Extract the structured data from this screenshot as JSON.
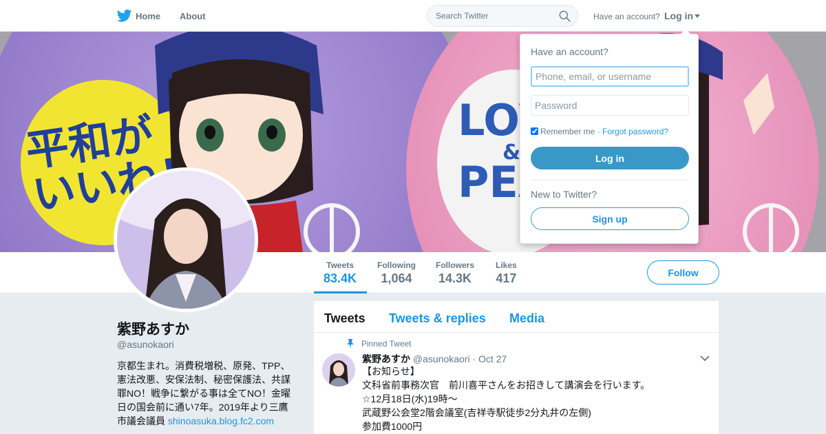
{
  "nav": {
    "home_label": "Home",
    "about_label": "About",
    "search_placeholder": "Search Twitter",
    "have_account": "Have an account?",
    "login_label": "Log in",
    "logo_icon": "twitter-bird-icon",
    "search_icon": "search-icon"
  },
  "colors": {
    "accent": "#1b95e0",
    "button_blue": "#3a98c8",
    "muted": "#657786",
    "background": "#e6ecf0"
  },
  "banner": {
    "badge_left_text_line1": "平和が",
    "badge_left_text_line2": "いいね！",
    "badge_right_text_line1": "LOV",
    "badge_right_text_line2": "&",
    "badge_right_text_line3": "PEA"
  },
  "profile": {
    "name": "紫野あすか",
    "handle": "@asunokaori",
    "bio": "京都生まれ。消費税増税、原発、TPP、憲法改悪、安保法制、秘密保護法、共謀罪NO！戦争に繋がる事は全てNO！金曜日の国会前に通い7年。2019年より三鷹市議会議員 ",
    "bio_link": "shinoasuka.blog.fc2.com"
  },
  "stats": [
    {
      "label": "Tweets",
      "value": "83.4K"
    },
    {
      "label": "Following",
      "value": "1,064"
    },
    {
      "label": "Followers",
      "value": "14.3K"
    },
    {
      "label": "Likes",
      "value": "417"
    }
  ],
  "follow_label": "Follow",
  "timeline": {
    "tabs": [
      "Tweets",
      "Tweets & replies",
      "Media"
    ],
    "pinned_label": "Pinned Tweet",
    "tweet": {
      "name": "紫野あすか",
      "handle": "@asunokaori",
      "date": "· Oct 27",
      "lines": [
        "【お知らせ】",
        "文科省前事務次官　前川喜平さんをお招きして講演会を行います。",
        "☆12月18日(水)19時～",
        "武蔵野公会堂2階会議室(吉祥寺駅徒歩2分丸井の左側)",
        "参加費1000円"
      ]
    }
  },
  "login_dropdown": {
    "title": "Have an account?",
    "username_placeholder": "Phone, email, or username",
    "password_placeholder": "Password",
    "remember_label": "Remember me",
    "separator": " · ",
    "forgot_label": "Forgot password?",
    "login_button": "Log in",
    "new_label": "New to Twitter?",
    "signup_button": "Sign up"
  }
}
